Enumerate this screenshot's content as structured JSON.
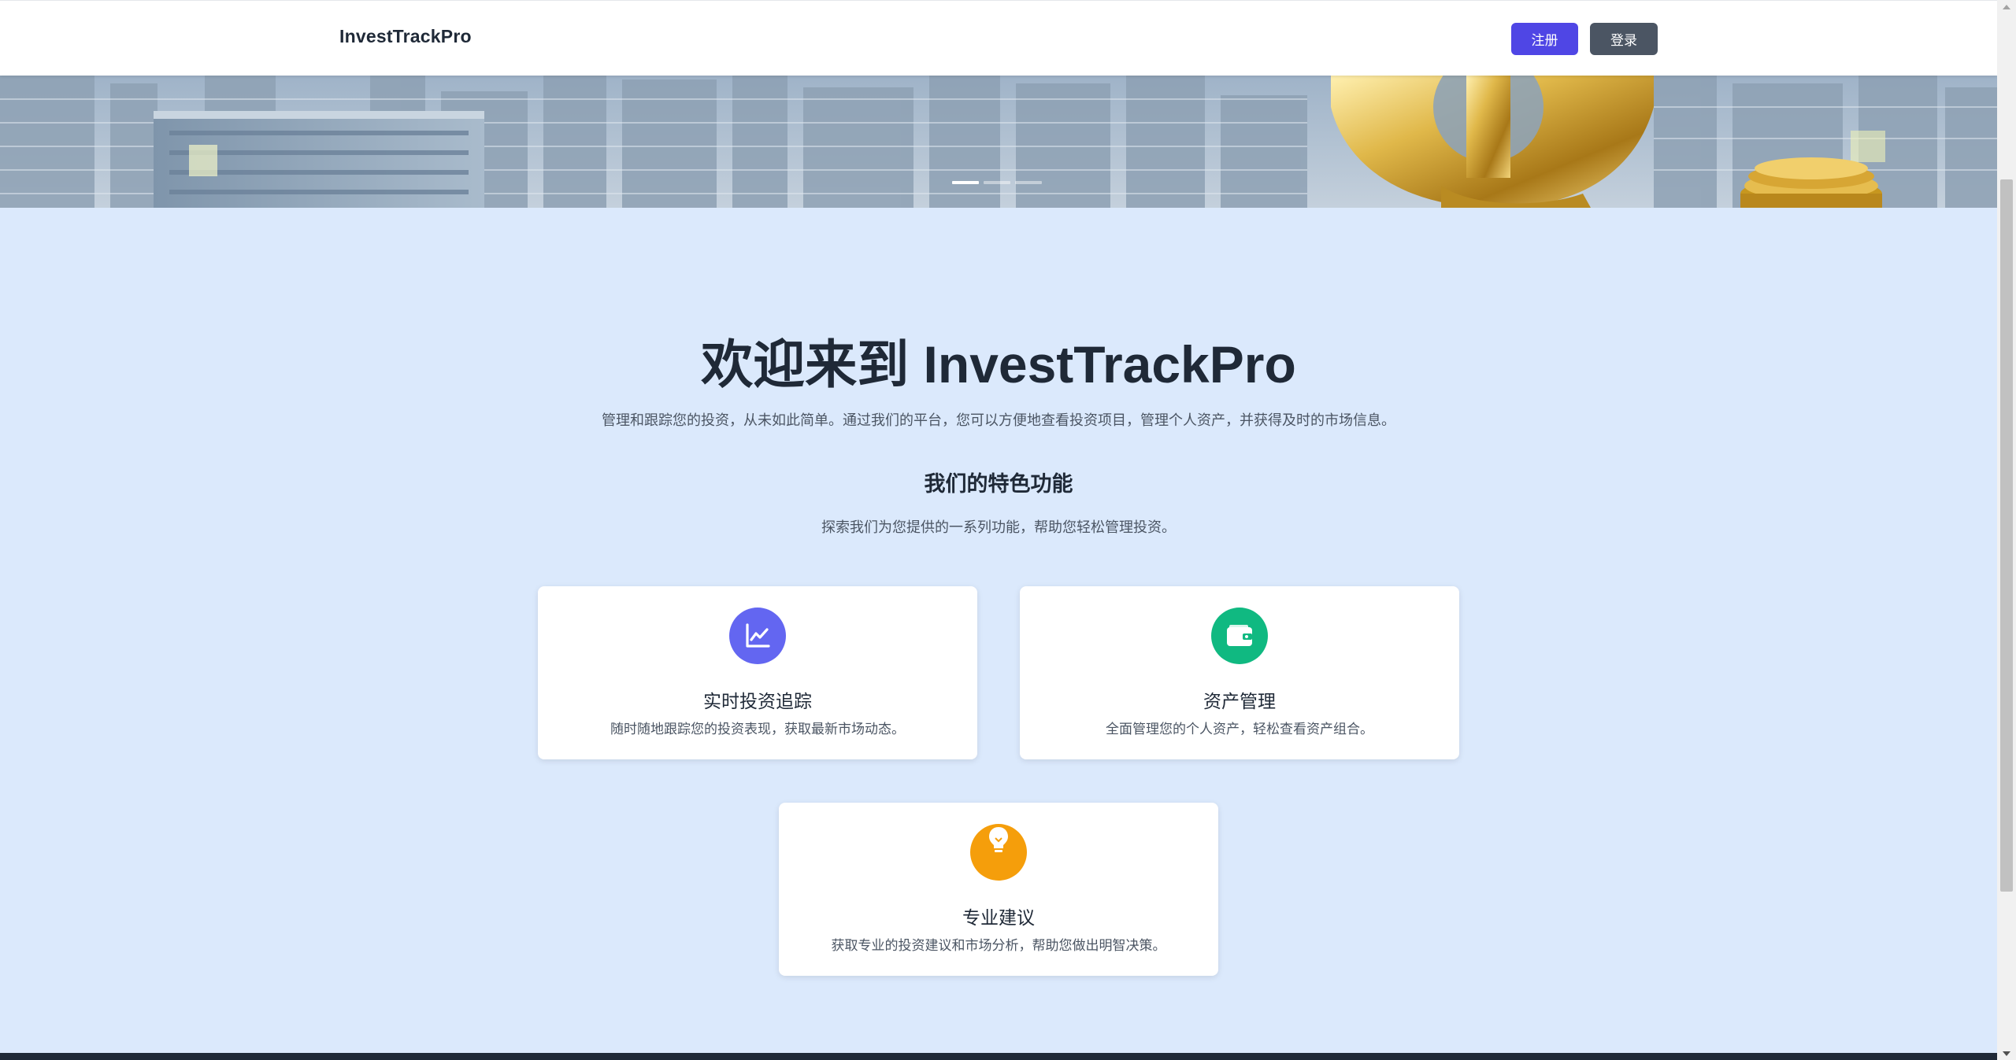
{
  "header": {
    "brand": "InvestTrackPro",
    "register_label": "注册",
    "login_label": "登录"
  },
  "carousel": {
    "slide_count": 3,
    "active_index": 0
  },
  "hero": {
    "title": "欢迎来到 InvestTrackPro",
    "subtitle": "管理和跟踪您的投资，从未如此简单。通过我们的平台，您可以方便地查看投资项目，管理个人资产，并获得及时的市场信息。"
  },
  "features": {
    "title": "我们的特色功能",
    "subtitle": "探索我们为您提供的一系列功能，帮助您轻松管理投资。",
    "items": [
      {
        "icon": "chart-line-icon",
        "color": "#6366f1",
        "title": "实时投资追踪",
        "desc": "随时随地跟踪您的投资表现，获取最新市场动态。"
      },
      {
        "icon": "wallet-icon",
        "color": "#10b981",
        "title": "资产管理",
        "desc": "全面管理您的个人资产，轻松查看资产组合。"
      },
      {
        "icon": "lightbulb-icon",
        "color": "#f59e0b",
        "title": "专业建议",
        "desc": "获取专业的投资建议和市场分析，帮助您做出明智决策。"
      }
    ]
  },
  "colors": {
    "page_bg": "#dbe9fc",
    "register_button": "#4f46e5",
    "login_button": "#4b5563",
    "footer": "#1f2937"
  }
}
